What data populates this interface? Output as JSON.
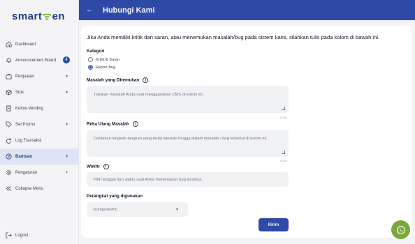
{
  "brand": {
    "left": "smart",
    "mid": "ᯤ",
    "right": "en"
  },
  "sidebar": {
    "items": [
      {
        "label": "Dashboard",
        "icon": "home-icon"
      },
      {
        "label": "Announcement Board",
        "icon": "bell-icon",
        "badge": "4"
      },
      {
        "label": "Penjualan",
        "icon": "briefcase-icon",
        "chevron": "▾"
      },
      {
        "label": "Stok",
        "icon": "box-icon",
        "chevron": "▾"
      },
      {
        "label": "Kelola Vending",
        "icon": "vending-icon"
      },
      {
        "label": "Set Promo",
        "icon": "tag-icon",
        "chevron": "▾"
      },
      {
        "label": "Log Transaksi",
        "icon": "refresh-icon"
      },
      {
        "label": "Bantuan",
        "icon": "help-icon",
        "chevron": "▾",
        "active": true
      },
      {
        "label": "Pengaturan",
        "icon": "gear-icon",
        "chevron": "▾"
      },
      {
        "label": "Collapse Menu",
        "icon": "collapse-icon"
      }
    ],
    "logout": "Logout"
  },
  "header": {
    "back": "←",
    "title": "Hubungi Kami"
  },
  "form": {
    "intro": "Jika Anda memiliki kritik dan saran, atau menemukan masalah/bug pada sistem kami, silahkan tulis pada kolom di bawah ini.",
    "category_label": "Kategori",
    "category_options": [
      "Kritik & Saran",
      "Report Bug"
    ],
    "category_selected": "Report Bug",
    "problem_label": "Masalah yang Ditemukan",
    "problem_placeholder": "Tuliskan masalah Anda saat menggunakan CMS di kolom ini.",
    "problem_counter": "0/250",
    "repro_label": "Reka Ulang Masalah",
    "repro_placeholder": "Ceritakan langkah-langkah yang Anda lakukan hingga terjadi masalah / bug tersebut di kolom ini.",
    "repro_counter": "0/250",
    "time_label": "Waktu",
    "time_placeholder": "Pilih tanggal dan waktu saat Anda menemukan bug tersebut.",
    "device_label": "Perangkat yang digunakan",
    "device_value": "Komputer/PC",
    "submit": "Kirim"
  },
  "info_glyph": "i",
  "colors": {
    "primary": "#2f4aa6",
    "brand_green": "#8ab33a",
    "fab_green": "#7aa83a"
  }
}
